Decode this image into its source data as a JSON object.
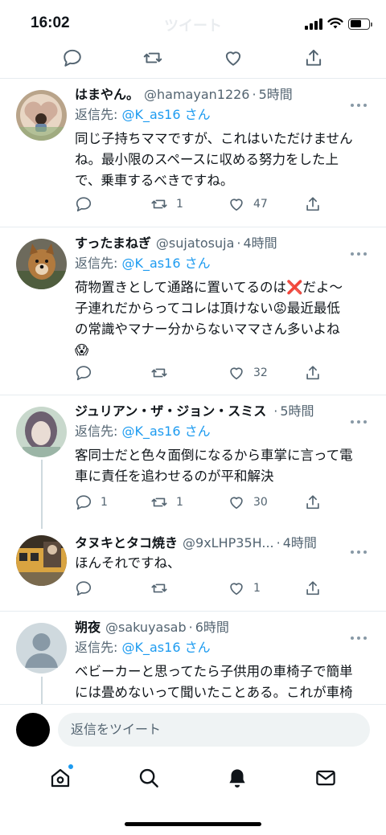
{
  "status": {
    "time": "16:02",
    "ghost_title": "ツイート"
  },
  "tweets": [
    {
      "name": "はまやん。",
      "handle": "@hamayan1226",
      "ago": "5時間",
      "reply_prefix": "返信先:",
      "reply_mention": "@K_as16 さん",
      "lines": [
        "同じ子持ちママですが、これはいただけません",
        "ね。最小限のスペースに収める努力をした上",
        "で、乗車するべきですね。"
      ],
      "replies": "",
      "retweets": "1",
      "likes": "47"
    },
    {
      "name": "すったまねぎ",
      "handle": "@sujatosuja",
      "ago": "4時間",
      "reply_prefix": "返信先:",
      "reply_mention": "@K_as16 さん",
      "lines": [
        "荷物置きとして通路に置いてるのは❌だよ〜",
        "子連れだからってコレは頂けない😡最近最低",
        "の常識やマナー分からないママさん多いよね",
        "😱"
      ],
      "replies": "",
      "retweets": "",
      "likes": "32"
    },
    {
      "name": "ジュリアン・ザ・ジョン・スミス",
      "handle": "",
      "ago": "5時間",
      "reply_prefix": "返信先:",
      "reply_mention": "@K_as16 さん",
      "lines": [
        "客同士だと色々面倒になるから車掌に言って電",
        "車に責任を追わせるのが平和解決"
      ],
      "replies": "1",
      "retweets": "1",
      "likes": "30"
    },
    {
      "name": "タヌキとタコ焼き",
      "handle": "@9xLHP35H...",
      "ago": "4時間",
      "lines": [
        "ほんそれですね、"
      ],
      "replies": "",
      "retweets": "",
      "likes": "1"
    },
    {
      "name": "朔夜",
      "handle": "@sakuyasab",
      "ago": "6時間",
      "reply_prefix": "返信先:",
      "reply_mention": "@K_as16 さん",
      "lines": [
        "ベビーカーと思ってたら子供用の車椅子で簡単",
        "には畳めないって聞いたことある。これが車椅"
      ]
    }
  ],
  "composer": {
    "placeholder": "返信をツイート"
  },
  "colors": {
    "accent": "#1d9bf0",
    "muted": "#536471",
    "divider": "#e6ecf0"
  }
}
